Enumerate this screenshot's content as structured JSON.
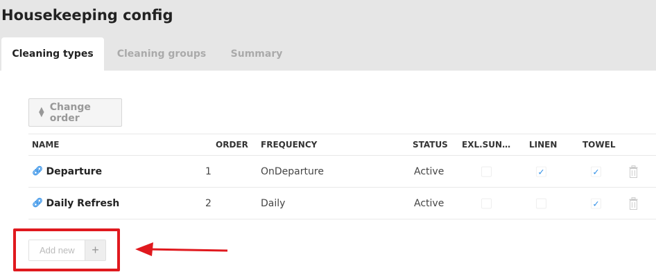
{
  "header": {
    "title": "Housekeeping config"
  },
  "tabs": [
    {
      "label": "Cleaning types",
      "active": true
    },
    {
      "label": "Cleaning groups",
      "active": false
    },
    {
      "label": "Summary",
      "active": false
    }
  ],
  "toolbar": {
    "change_order_label": "Change order",
    "change_order_icon": "sort-icon"
  },
  "table": {
    "columns": [
      "NAME",
      "ORDER",
      "FREQUENCY",
      "STATUS",
      "EXL.SUN…",
      "LINEN",
      "TOWEL"
    ],
    "rows": [
      {
        "name": "Departure",
        "order": "1",
        "frequency": "OnDeparture",
        "status": "Active",
        "exl_sun": false,
        "linen": true,
        "towel": true
      },
      {
        "name": "Daily Refresh",
        "order": "2",
        "frequency": "Daily",
        "status": "Active",
        "exl_sun": false,
        "linen": false,
        "towel": true
      }
    ]
  },
  "add_new": {
    "placeholder": "Add new",
    "button_icon": "plus-icon"
  },
  "annotation": {
    "color": "#e0191e"
  },
  "colors": {
    "accent": "#2b8ce6",
    "background": "#e6e6e6"
  }
}
